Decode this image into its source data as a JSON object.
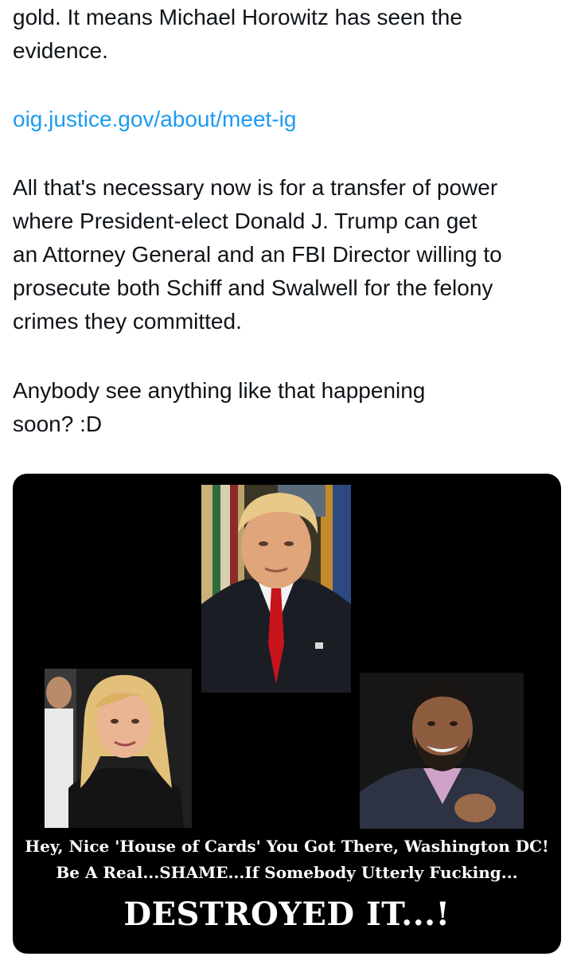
{
  "post": {
    "paragraph_1": "gold.  It means Michael Horowitz has seen the\nevidence.",
    "link": "oig.justice.gov/about/meet-ig",
    "paragraph_3": "All that's necessary now is for a transfer of power\nwhere President-elect Donald J. Trump can get\nan Attorney General and an FBI Director willing to\nprosecute both Schiff and Swalwell for the felony\ncrimes they committed.",
    "paragraph_4": "Anybody see anything like that happening\nsoon?  :D"
  },
  "media": {
    "caption_line_1": "Hey, Nice 'House of Cards' You Got There, Washington DC!",
    "caption_line_2": "Be A Real...SHAME...If Somebody Utterly Fucking...",
    "caption_line_3": "DESTROYED IT...!"
  },
  "colors": {
    "text": "#0f1419",
    "link": "#1d9bf0",
    "media_background": "#000000"
  }
}
